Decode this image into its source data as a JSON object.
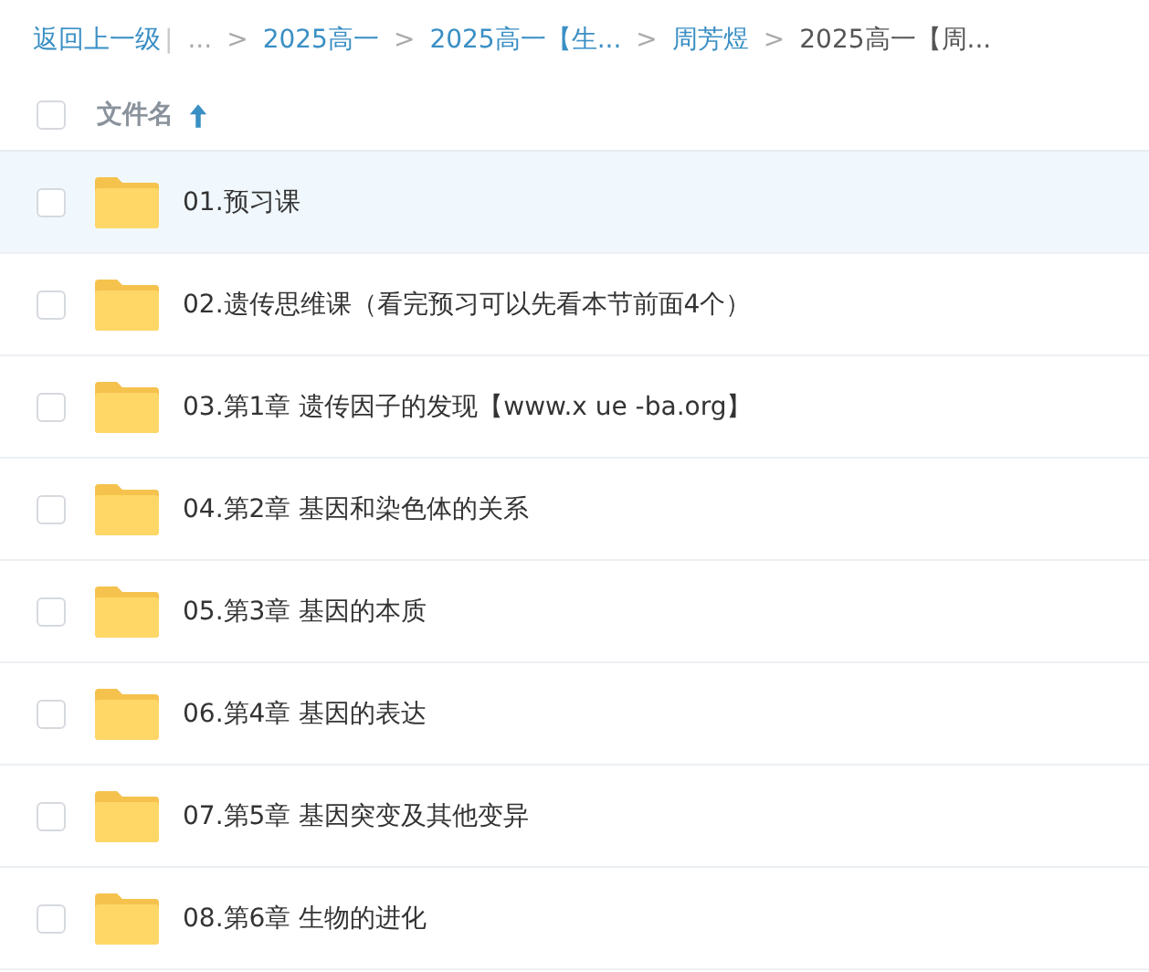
{
  "breadcrumb": [
    {
      "kind": "back",
      "label": "返回上一级"
    },
    {
      "kind": "divider",
      "label": "|"
    },
    {
      "kind": "ellipsis",
      "label": "..."
    },
    {
      "kind": "sep",
      "label": ">"
    },
    {
      "kind": "link",
      "label": "2025高一"
    },
    {
      "kind": "sep",
      "label": ">"
    },
    {
      "kind": "link",
      "label": "2025高一【生..."
    },
    {
      "kind": "sep",
      "label": ">"
    },
    {
      "kind": "link",
      "label": "周芳煜"
    },
    {
      "kind": "sep",
      "label": ">"
    },
    {
      "kind": "current",
      "label": "2025高一【周..."
    }
  ],
  "header": {
    "checked": false,
    "column": "文件名",
    "ascending": true
  },
  "rows": [
    {
      "name": "01.预习课",
      "checked": false,
      "highlighted": true
    },
    {
      "name": "02.遗传思维课（看完预习可以先看本节前面4个）",
      "checked": false,
      "highlighted": false
    },
    {
      "name": "03.第1章 遗传因子的发现【www.x ue -ba.org】",
      "checked": false,
      "highlighted": false
    },
    {
      "name": "04.第2章 基因和染色体的关系",
      "checked": false,
      "highlighted": false
    },
    {
      "name": "05.第3章 基因的本质",
      "checked": false,
      "highlighted": false
    },
    {
      "name": "06.第4章 基因的表达",
      "checked": false,
      "highlighted": false
    },
    {
      "name": "07.第5章 基因突变及其他变异",
      "checked": false,
      "highlighted": false
    },
    {
      "name": "08.第6章 生物的进化",
      "checked": false,
      "highlighted": false
    }
  ]
}
